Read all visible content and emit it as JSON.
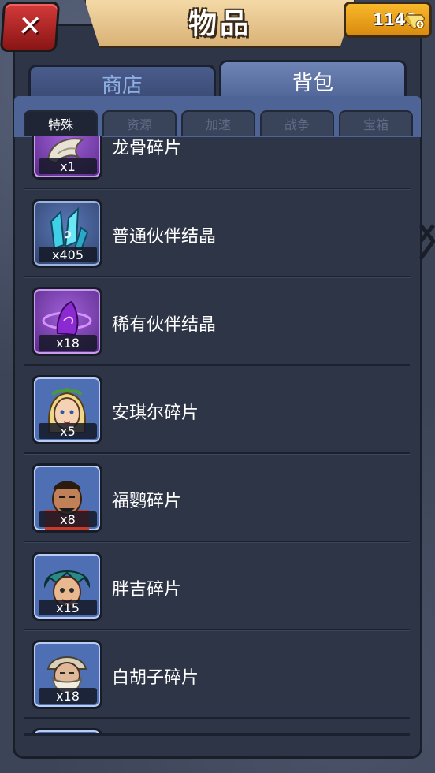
{
  "header": {
    "title": "物品",
    "close_icon": "close-icon",
    "gem_count": "1148",
    "gem_icon": "diamond-plus-icon"
  },
  "main_tabs": [
    {
      "label": "商店",
      "active": false
    },
    {
      "label": "背包",
      "active": true
    }
  ],
  "sub_tabs": [
    {
      "label": "特殊",
      "active": true
    },
    {
      "label": "资源",
      "active": false
    },
    {
      "label": "加速",
      "active": false
    },
    {
      "label": "战争",
      "active": false
    },
    {
      "label": "宝箱",
      "active": false
    }
  ],
  "items": [
    {
      "name": "龙骨碎片",
      "count": "x1",
      "icon": "dragon-bone-icon",
      "frame": "purple"
    },
    {
      "name": "普通伙伴结晶",
      "count": "x405",
      "icon": "blue-crystal-icon",
      "frame": "blue"
    },
    {
      "name": "稀有伙伴结晶",
      "count": "x18",
      "icon": "purple-crystal-icon",
      "frame": "purple"
    },
    {
      "name": "安琪尔碎片",
      "count": "x5",
      "icon": "hero-angel-portrait-icon",
      "frame": "hero"
    },
    {
      "name": "福鹦碎片",
      "count": "x8",
      "icon": "hero-warrior-portrait-icon",
      "frame": "hero"
    },
    {
      "name": "胖吉碎片",
      "count": "x15",
      "icon": "hero-teal-hair-portrait-icon",
      "frame": "hero"
    },
    {
      "name": "白胡子碎片",
      "count": "x18",
      "icon": "hero-old-wizard-portrait-icon",
      "frame": "hero"
    }
  ],
  "colors": {
    "accent_gold": "#f8b82a",
    "tab_active": "#6e84b4",
    "frame_purple": "#a060d8",
    "frame_blue": "#5a78b8"
  }
}
